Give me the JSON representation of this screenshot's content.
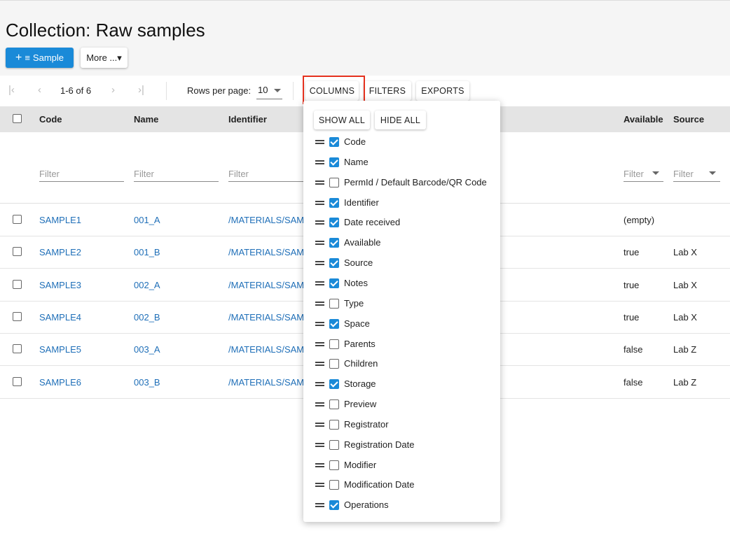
{
  "page": {
    "title": "Collection: Raw samples"
  },
  "actions": {
    "add_label": "Sample",
    "more_label": "More ...▾"
  },
  "pagination": {
    "first_icon": "|‹",
    "prev_icon": "‹",
    "next_icon": "›",
    "last_icon": "›|",
    "range": "1-6 of 6",
    "rows_per_page_label": "Rows per page:",
    "rows_per_page_value": "10"
  },
  "toolbar": {
    "columns_label": "COLUMNS",
    "filters_label": "FILTERS",
    "exports_label": "EXPORTS"
  },
  "table": {
    "headers": {
      "code": "Code",
      "name": "Name",
      "identifier": "Identifier",
      "available": "Available",
      "source": "Source"
    },
    "filter_placeholder": "Filter",
    "rows": [
      {
        "code": "SAMPLE1",
        "name": "001_A",
        "identifier": "/MATERIALS/SAM",
        "available": "(empty)",
        "source": ""
      },
      {
        "code": "SAMPLE2",
        "name": "001_B",
        "identifier": "/MATERIALS/SAM",
        "available": "true",
        "source": "Lab X"
      },
      {
        "code": "SAMPLE3",
        "name": "002_A",
        "identifier": "/MATERIALS/SAM",
        "available": "true",
        "source": "Lab X"
      },
      {
        "code": "SAMPLE4",
        "name": "002_B",
        "identifier": "/MATERIALS/SAM",
        "available": "true",
        "source": "Lab X"
      },
      {
        "code": "SAMPLE5",
        "name": "003_A",
        "identifier": "/MATERIALS/SAM",
        "available": "false",
        "source": "Lab Z"
      },
      {
        "code": "SAMPLE6",
        "name": "003_B",
        "identifier": "/MATERIALS/SAM",
        "available": "false",
        "source": "Lab Z"
      }
    ]
  },
  "columns_popup": {
    "show_all_label": "SHOW ALL",
    "hide_all_label": "HIDE ALL",
    "items": [
      {
        "label": "Code",
        "checked": true
      },
      {
        "label": "Name",
        "checked": true
      },
      {
        "label": "PermId / Default Barcode/QR Code",
        "checked": false
      },
      {
        "label": "Identifier",
        "checked": true
      },
      {
        "label": "Date received",
        "checked": true
      },
      {
        "label": "Available",
        "checked": true
      },
      {
        "label": "Source",
        "checked": true
      },
      {
        "label": "Notes",
        "checked": true
      },
      {
        "label": "Type",
        "checked": false
      },
      {
        "label": "Space",
        "checked": true
      },
      {
        "label": "Parents",
        "checked": false
      },
      {
        "label": "Children",
        "checked": false
      },
      {
        "label": "Storage",
        "checked": true
      },
      {
        "label": "Preview",
        "checked": false
      },
      {
        "label": "Registrator",
        "checked": false
      },
      {
        "label": "Registration Date",
        "checked": false
      },
      {
        "label": "Modifier",
        "checked": false
      },
      {
        "label": "Modification Date",
        "checked": false
      },
      {
        "label": "Operations",
        "checked": true
      }
    ]
  },
  "colors": {
    "accent": "#1a8ad8",
    "link": "#1f6fb8",
    "highlight": "#e5321f"
  }
}
